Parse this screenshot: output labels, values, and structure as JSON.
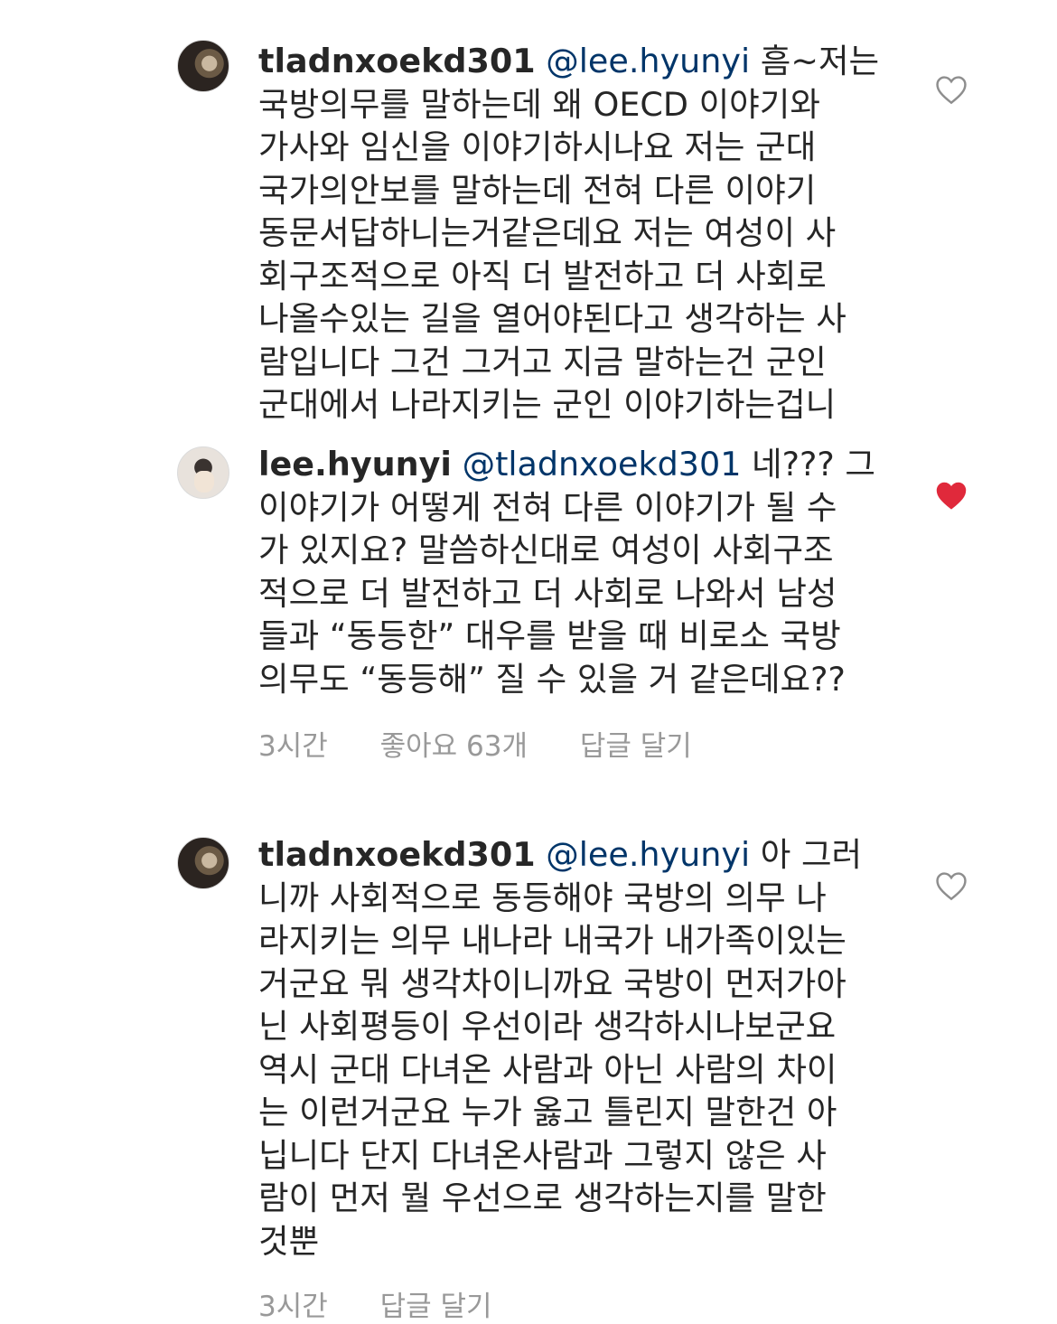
{
  "comments": [
    {
      "username": "tladnxoekd301",
      "mention": "@lee.hyunyi",
      "text": "흠~저는\n국방의무를 말하는데 왜 OECD 이야기와\n가사와 임신을 이야기하시나요 저는 군대\n국가의안보를 말하는데 전혀 다른 이야기\n동문서답하니는거같은데요 저는 여성이 사\n회구조적으로 아직 더 발전하고 더 사회로\n나올수있는 길을 열어야된다고 생각하는 사\n람입니다 그건 그거고 지금 말하는건 군인\n군대에서 나라지키는 군인 이야기하는겁니",
      "liked": false,
      "heart_color": "#8e8e8e"
    },
    {
      "username": "lee.hyunyi",
      "mention": "@tladnxoekd301",
      "text": "네??? 그\n이야기가 어떻게 전혀 다른 이야기가 될 수\n가 있지요? 말씀하신대로 여성이 사회구조\n적으로 더 발전하고 더 사회로 나와서 남성\n들과 “동등한” 대우를 받을 때 비로소 국방\n의무도 “동등해” 질 수 있을 거 같은데요??",
      "liked": true,
      "heart_color": "#e0293b",
      "meta": {
        "time": "3시간",
        "likes": "좋아요 63개",
        "reply": "답글 달기"
      }
    },
    {
      "username": "tladnxoekd301",
      "mention": "@lee.hyunyi",
      "text": "아 그러\n니까 사회적으로 동등해야 국방의 의무 나\n라지키는 의무 내나라 내국가 내가족이있는\n거군요 뭐 생각차이니까요 국방이 먼저가아\n닌 사회평등이 우선이라 생각하시나보군요\n역시 군대 다녀온 사람과 아닌 사람의 차이\n는 이런거군요 누가 옳고 틀린지 말한건 아\n닙니다 단지 다녀온사람과 그렇지 않은 사\n람이 먼저 뭘 우선으로 생각하는지를 말한\n것뿐",
      "liked": false,
      "heart_color": "#8e8e8e",
      "meta": {
        "time": "3시간",
        "reply": "답글 달기"
      }
    }
  ]
}
